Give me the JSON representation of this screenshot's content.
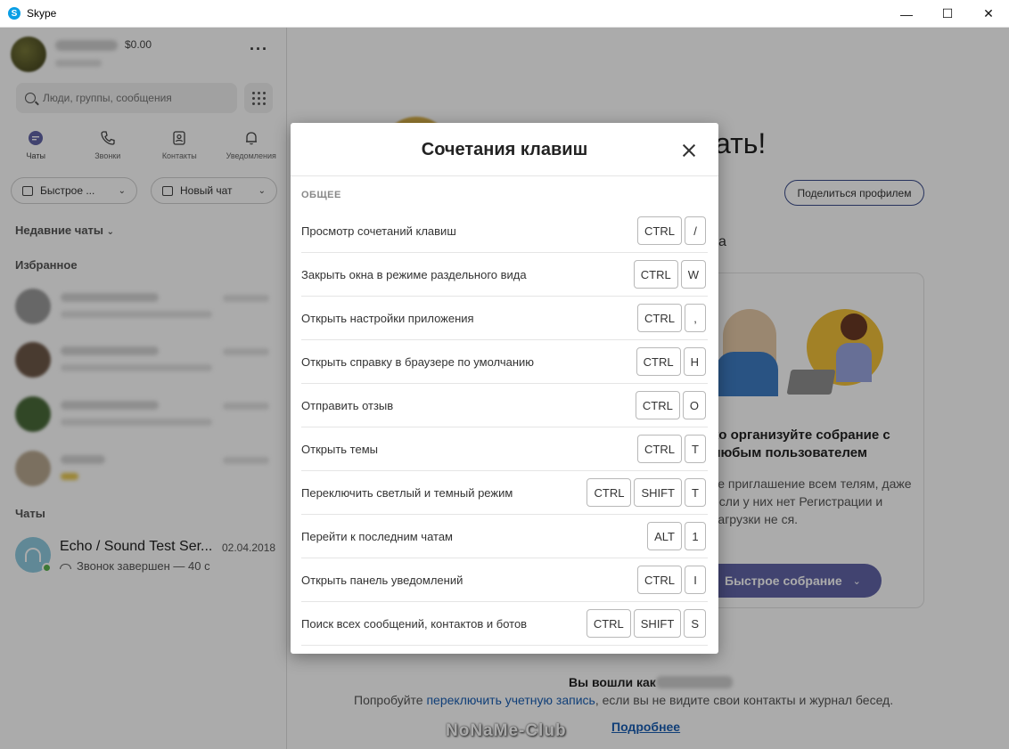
{
  "window": {
    "title": "Skype",
    "controls": {
      "minimize": "—",
      "maximize": "☐",
      "close": "✕"
    }
  },
  "sidebar": {
    "balance": "$0.00",
    "search_placeholder": "Люди, группы, сообщения",
    "nav": [
      {
        "label": "Чаты",
        "icon": "chat-icon"
      },
      {
        "label": "Звонки",
        "icon": "phone-icon"
      },
      {
        "label": "Контакты",
        "icon": "contacts-icon"
      },
      {
        "label": "Уведомления",
        "icon": "bell-icon"
      }
    ],
    "quick_meeting_label": "Быстрое ...",
    "new_chat_label": "Новый чат",
    "recent_chats_label": "Недавние чаты",
    "favorites_label": "Избранное",
    "chats_label": "Чаты",
    "echo_chat": {
      "name": "Echo / Sound Test Ser...",
      "date": "02.04.2018",
      "status": "Звонок завершен — 40 с"
    }
  },
  "main": {
    "welcome_title_fragment": "ать!",
    "share_profile": "Поделиться профилем",
    "fragment_a": "а",
    "meeting_card": {
      "title": "ко организуйте собрание с любым пользователем",
      "text": "те приглашение всем телям, даже если у них нет Регистрации и загрузки не ся.",
      "button": "Быстрое собрание"
    },
    "signed_in_as": "Вы вошли как",
    "switch_prefix": "Попробуйте ",
    "switch_link": "переключить учетную запись",
    "switch_suffix": ", если вы не видите свои контакты и журнал бесед.",
    "learn_more": "Подробнее",
    "watermark": "NoNaMe-Club"
  },
  "modal": {
    "title": "Сочетания клавиш",
    "group": "ОБЩЕЕ",
    "shortcuts": [
      {
        "label": "Просмотр сочетаний клавиш",
        "keys": [
          "CTRL",
          "/"
        ]
      },
      {
        "label": "Закрыть окна в режиме раздельного вида",
        "keys": [
          "CTRL",
          "W"
        ]
      },
      {
        "label": "Открыть настройки приложения",
        "keys": [
          "CTRL",
          ","
        ]
      },
      {
        "label": "Открыть справку в браузере по умолчанию",
        "keys": [
          "CTRL",
          "H"
        ]
      },
      {
        "label": "Отправить отзыв",
        "keys": [
          "CTRL",
          "O"
        ]
      },
      {
        "label": "Открыть темы",
        "keys": [
          "CTRL",
          "T"
        ]
      },
      {
        "label": "Переключить светлый и темный режим",
        "keys": [
          "CTRL",
          "SHIFT",
          "T"
        ]
      },
      {
        "label": "Перейти к последним чатам",
        "keys": [
          "ALT",
          "1"
        ]
      },
      {
        "label": "Открыть панель уведомлений",
        "keys": [
          "CTRL",
          "I"
        ]
      },
      {
        "label": "Поиск всех сообщений, контактов и ботов",
        "keys": [
          "CTRL",
          "SHIFT",
          "S"
        ]
      }
    ]
  }
}
